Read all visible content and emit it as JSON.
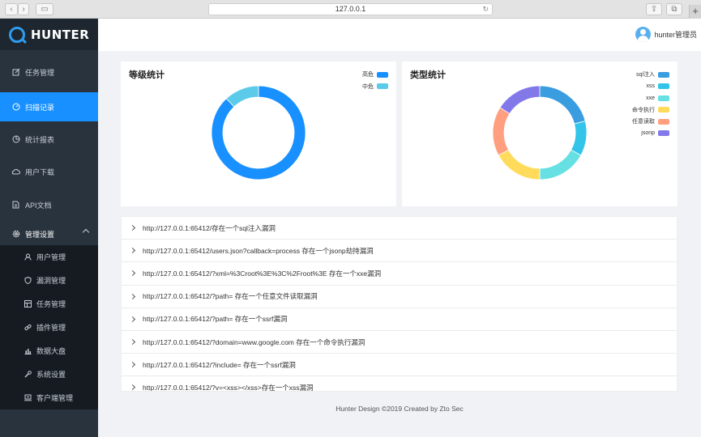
{
  "browser": {
    "url": "127.0.0.1"
  },
  "brand": {
    "name": "HUNTER"
  },
  "user": {
    "name": "hunter管理员"
  },
  "nav": {
    "items": [
      {
        "label": "任务管理",
        "icon": "edit-icon"
      },
      {
        "label": "扫描记录",
        "icon": "dashboard-icon",
        "active": true
      },
      {
        "label": "统计报表",
        "icon": "pie-chart-icon"
      },
      {
        "label": "用户下载",
        "icon": "cloud-icon"
      },
      {
        "label": "API文档",
        "icon": "document-icon"
      }
    ],
    "settings": {
      "label": "管理设置",
      "icon": "gear-icon"
    },
    "sub_items": [
      {
        "label": "用户管理",
        "icon": "user-icon"
      },
      {
        "label": "漏洞管理",
        "icon": "shield-icon"
      },
      {
        "label": "任务管理",
        "icon": "table-icon"
      },
      {
        "label": "插件管理",
        "icon": "link-icon"
      },
      {
        "label": "数据大盘",
        "icon": "bar-chart-icon"
      },
      {
        "label": "系统设置",
        "icon": "wrench-icon"
      },
      {
        "label": "客户端管理",
        "icon": "laptop-icon"
      }
    ]
  },
  "chart_data": [
    {
      "type": "pie",
      "title": "等级统计",
      "legend_position": "top-right",
      "categories": [
        "高危",
        "中危"
      ],
      "values": [
        88,
        12
      ],
      "colors": [
        "#1890ff",
        "#5ccbea"
      ]
    },
    {
      "type": "pie",
      "title": "类型统计",
      "legend_position": "top-right",
      "categories": [
        "sql注入",
        "xss",
        "xxe",
        "命令执行",
        "任意读取",
        "jsonp"
      ],
      "values": [
        21,
        12,
        17,
        17,
        17,
        16
      ],
      "colors": [
        "#3a9de0",
        "#32c5e9",
        "#67e0e3",
        "#ffdb5c",
        "#ff9f7f",
        "#8378ea"
      ]
    }
  ],
  "vulns": [
    "http://127.0.0.1:65412/存在一个sql注入漏洞",
    "http://127.0.0.1:65412/users.json?callback=process 存在一个jsonp劫持漏洞",
    "http://127.0.0.1:65412/?xml=%3Croot%3E%3C%2Froot%3E 存在一个xxe漏洞",
    "http://127.0.0.1:65412/?path= 存在一个任意文件读取漏洞",
    "http://127.0.0.1:65412/?path= 存在一个ssrf漏洞",
    "http://127.0.0.1:65412/?domain=www.google.com 存在一个命令执行漏洞",
    "http://127.0.0.1:65412/?include= 存在一个ssrf漏洞",
    "http://127.0.0.1:65412/?v=<xss></xss>存在一个xss漏洞"
  ],
  "footer": {
    "text": "Hunter Design ©2019 Created by Zto Sec"
  }
}
